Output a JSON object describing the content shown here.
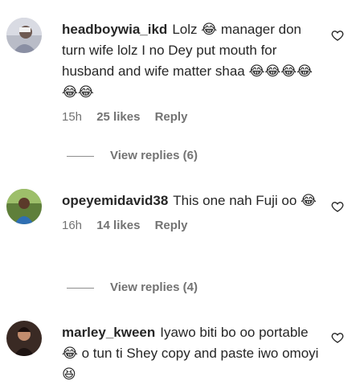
{
  "comments": [
    {
      "username": "headboywia_ikd",
      "text": "Lolz 😂 manager don turn wife lolz I no Dey put mouth for husband and wife matter shaa 😂😂😂😂😂😂",
      "time": "15h",
      "likes": "25 likes",
      "reply_label": "Reply",
      "view_replies": "View replies (6)"
    },
    {
      "username": "opeyemidavid38",
      "text": "This one nah Fuji oo 😂",
      "time": "16h",
      "likes": "14 likes",
      "reply_label": "Reply",
      "view_replies": "View replies (4)"
    },
    {
      "username": "marley_kween",
      "text": "Iyawo biti bo oo portable 😂 o tun ti Shey copy and paste iwo omoyi 😆",
      "time": "",
      "likes": "",
      "reply_label": "",
      "view_replies": ""
    }
  ],
  "icons": {
    "like": "heart-outline-icon"
  }
}
